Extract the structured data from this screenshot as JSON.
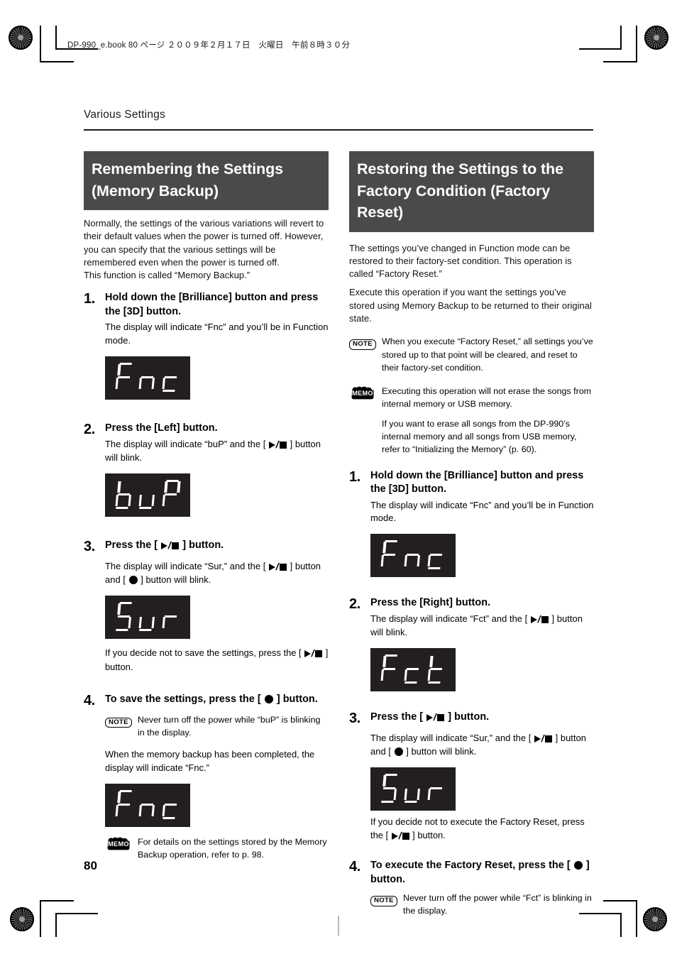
{
  "print_slug": "DP-990_e.book  80 ページ ２００９年２月１７日　火曜日　午前８時３０分",
  "running_head": "Various Settings",
  "page_number": "80",
  "colors": {
    "section_bar_bg": "#4a4a4a",
    "section_bar_text": "#ffffff",
    "lcd_bg": "#231f20",
    "lcd_segment": "#ffffff",
    "body_text": "#111111"
  },
  "icons": {
    "note_badge": "NOTE",
    "memo_badge": "MEMO",
    "play_stop": "play-stop-button-icon",
    "record": "record-button-icon"
  },
  "left_column": {
    "section_title": "Remembering the Settings (Memory Backup)",
    "intro": [
      "Normally, the settings of the various variations will revert to their default values when the power is turned off. However, you can specify that the various settings will be remembered even when the power is turned off.",
      "This function is called “Memory Backup.”"
    ],
    "steps": [
      {
        "num": "1.",
        "title": "Hold down the [Brilliance] button and press the [3D] button.",
        "desc": "The display will indicate “Fnc” and you’ll be in Function mode.",
        "lcd": "Fnc"
      },
      {
        "num": "2.",
        "title": "Press the [Left] button.",
        "desc_before": "The display will indicate “buP” and the [",
        "desc_after": "] button will blink.",
        "lcd": "buP"
      },
      {
        "num": "3.",
        "title_before": "Press the [",
        "title_after": "] button.",
        "desc_before": "The display will indicate “Sur,” and the [",
        "desc_mid": "] button and [",
        "desc_after": "] button will blink.",
        "lcd": "Sur",
        "after_lcd_before": "If you decide not to save the settings, press the [",
        "after_lcd_after": "] button."
      },
      {
        "num": "4.",
        "title_before": "To save the settings, press the [",
        "title_after": "] button.",
        "note": "Never turn off the power while “buP” is blinking in the display.",
        "after_note": "When the memory backup has been completed, the display will indicate “Fnc.”",
        "lcd": "Fnc",
        "memo": "For details on the settings stored by the Memory Backup operation, refer to p. 98."
      }
    ]
  },
  "right_column": {
    "section_title": "Restoring the Settings to the Factory Condition (Factory Reset)",
    "intro": [
      "The settings you’ve changed in Function mode can be restored to their factory-set condition. This operation is called “Factory Reset.”",
      "Execute this operation if you want the settings you’ve stored using Memory Backup to be returned to their original state."
    ],
    "note": "When you execute “Factory Reset,” all settings you’ve stored up to that point will be cleared, and reset to their factory-set condition.",
    "memo": [
      "Executing this operation will not erase the songs from internal memory or USB memory.",
      "If you want to erase all songs from the DP-990’s internal memory and all songs from USB memory, refer to “Initializing the Memory” (p. 60)."
    ],
    "steps": [
      {
        "num": "1.",
        "title": "Hold down the [Brilliance] button and press the [3D] button.",
        "desc": "The display will indicate “Fnc” and you’ll be in Function mode.",
        "lcd": "Fnc"
      },
      {
        "num": "2.",
        "title": "Press the [Right] button.",
        "desc_before": "The display will indicate “Fct” and the [",
        "desc_after": "] button will blink.",
        "lcd": "Fct"
      },
      {
        "num": "3.",
        "title_before": "Press the [",
        "title_after": "] button.",
        "desc_before": "The display will indicate “Sur,” and the [",
        "desc_mid": "] button and [",
        "desc_after": "] button will blink.",
        "lcd": "Sur",
        "after_lcd_before": "If you decide not to execute the Factory Reset, press the [",
        "after_lcd_after": "] button."
      },
      {
        "num": "4.",
        "title_before": "To execute the Factory Reset, press the [",
        "title_after": "] button.",
        "note": "Never turn off the power while “Fct” is blinking in the display."
      }
    ]
  }
}
